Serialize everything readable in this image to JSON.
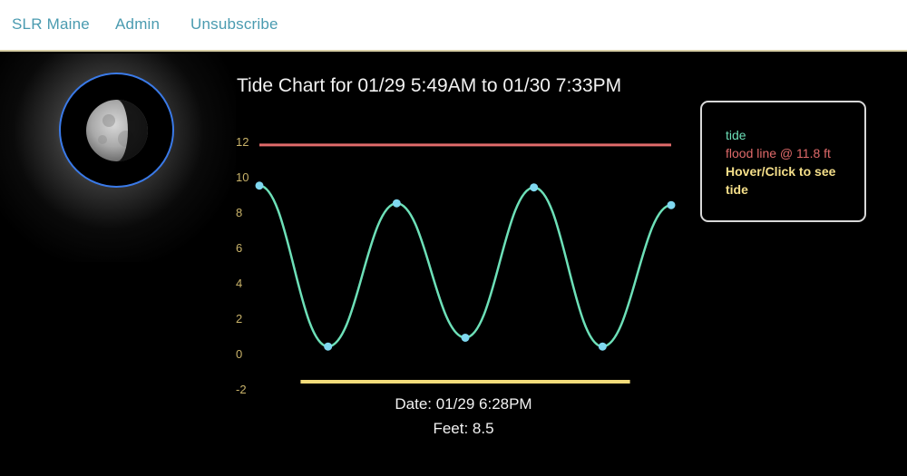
{
  "nav": {
    "brand": "SLR Maine",
    "admin": "Admin",
    "unsubscribe": "Unsubscribe"
  },
  "moon": {
    "icon": "waxing-crescent-moon-icon",
    "ring_color": "#3a7ae8"
  },
  "chart_title": "Tide Chart for 01/29 5:49AM to 01/30 7:33PM",
  "legend": {
    "tide": "tide",
    "flood": "flood line @ 11.8 ft",
    "hint": "Hover/Click to see tide"
  },
  "readout": {
    "date": "Date: 01/29 6:28PM",
    "feet": "Feet: 8.5"
  },
  "colors": {
    "background": "#000000",
    "nav_link": "#4a9bb0",
    "tide_line": "#6de0b8",
    "tide_point": "#7fd8f0",
    "flood_line": "#e06a6a",
    "axis_tick": "#c9b36a",
    "legend_hint": "#f5df8a",
    "selection_bar": "#f3dc7a"
  },
  "chart_data": {
    "type": "line",
    "title": "Tide Chart for 01/29 5:49AM to 01/30 7:33PM",
    "ylim": [
      -2,
      12
    ],
    "yticks": [
      "12",
      "10",
      "8",
      "6",
      "4",
      "2",
      "0",
      "-2"
    ],
    "grid": false,
    "legend_placement": "top-right",
    "x": [
      0,
      1,
      2,
      3,
      4,
      5,
      6
    ],
    "series": [
      {
        "name": "tide",
        "values": [
          9.5,
          0.4,
          8.5,
          0.9,
          9.4,
          0.4,
          8.4
        ]
      },
      {
        "name": "flood line @ 11.8 ft",
        "values": [
          11.8,
          11.8,
          11.8,
          11.8,
          11.8,
          11.8,
          11.8
        ]
      }
    ],
    "selection": {
      "from": 0.6,
      "to": 5.4
    }
  }
}
